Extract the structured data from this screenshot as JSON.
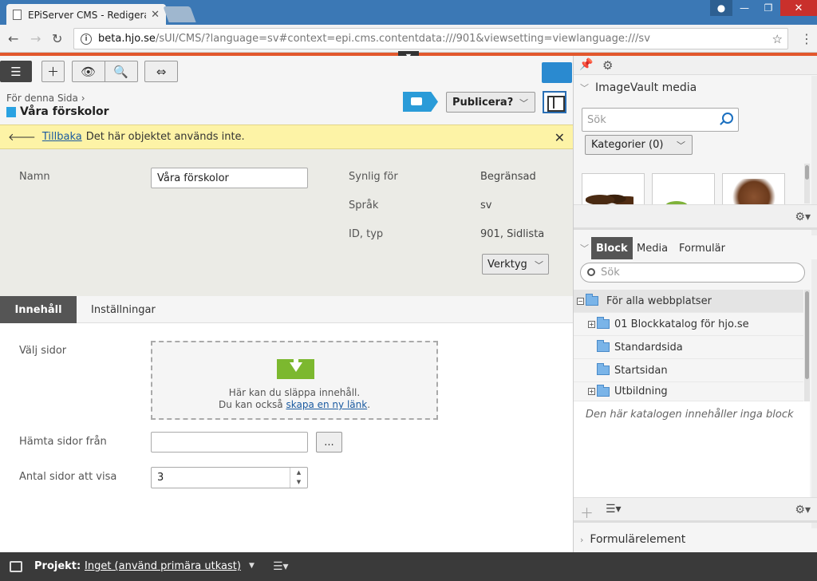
{
  "browser": {
    "tab_title": "EPiServer CMS - Redigera",
    "url_host": "beta.hjo.se",
    "url_path": "/sUI/CMS/?language=sv#context=epi.cms.contentdata:///901&viewsetting=viewlanguage:///sv"
  },
  "header": {
    "breadcrumb": "För denna Sida",
    "breadcrumb_sep": "›",
    "page_title": "Våra förskolor",
    "publish_label": "Publicera?"
  },
  "notice": {
    "back_link": "Tillbaka",
    "message": "Det här objektet används inte."
  },
  "properties": {
    "name_label": "Namn",
    "name_value": "Våra förskolor",
    "visible_label": "Synlig för",
    "visible_value": "Begränsad",
    "language_label": "Språk",
    "language_value": "sv",
    "id_label": "ID, typ",
    "id_value": "901, Sidlista",
    "tools_label": "Verktyg"
  },
  "tabs": {
    "content": "Innehåll",
    "settings": "Inställningar"
  },
  "form": {
    "select_pages_label": "Välj sidor",
    "drop_text": "Här kan du släppa innehåll.",
    "drop_text2": "Du kan också",
    "drop_link": "skapa en ny länk",
    "drop_end": ".",
    "fetch_from_label": "Hämta sidor från",
    "browse_label": "...",
    "count_label": "Antal sidor att visa",
    "count_value": "3"
  },
  "imagevault": {
    "title": "ImageVault media",
    "search_placeholder": "Sök",
    "category_label": "Kategorier (0)"
  },
  "library": {
    "tab_block": "Block",
    "tab_media": "Media",
    "tab_forms": "Formulär",
    "search_placeholder": "Sök",
    "tree": [
      {
        "label": "För alla webbplatser"
      },
      {
        "label": "01 Blockkatalog för hjo.se"
      },
      {
        "label": "Standardsida"
      },
      {
        "label": "Startsidan"
      },
      {
        "label": "Utbildning"
      }
    ],
    "empty_message": "Den här katalogen innehåller inga block"
  },
  "form_elements": {
    "title": "Formulärelement"
  },
  "project": {
    "label": "Projekt:",
    "value": "Inget (använd primära utkast)"
  },
  "colors": {
    "accent_orange": "#e2572c",
    "browser_blue": "#3b78b5",
    "notice_yellow": "#fdf3a6",
    "epi_blue": "#2a8ad0"
  }
}
